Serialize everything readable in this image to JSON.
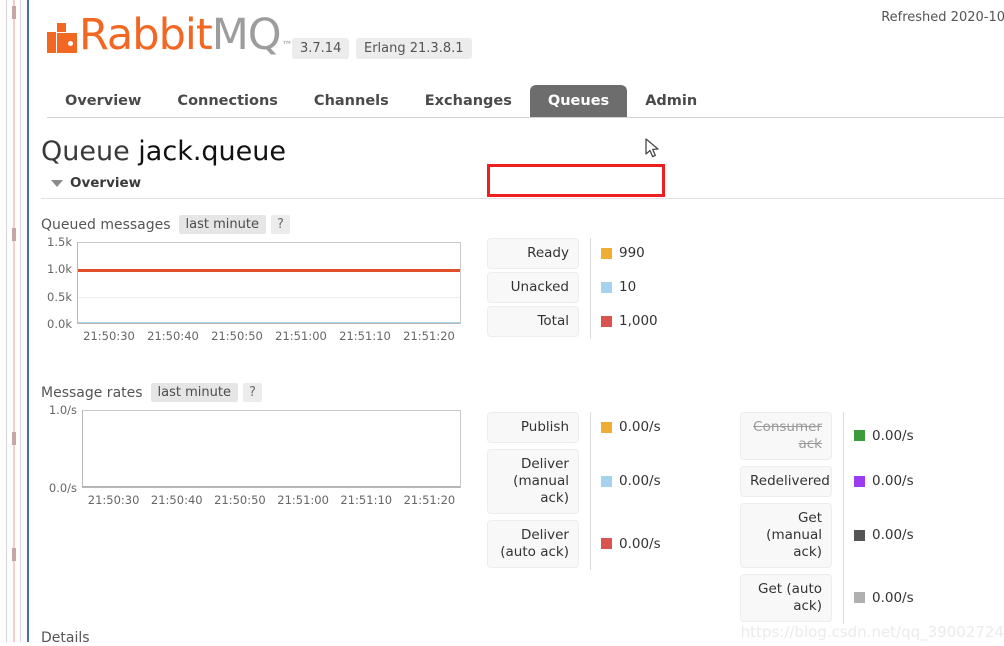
{
  "header": {
    "logo_rabbit": "Rabbit",
    "logo_mq": "MQ",
    "logo_tm": "™",
    "broker_version": "3.7.14",
    "erlang_version": "Erlang 21.3.8.1",
    "refreshed": "Refreshed 2020-10"
  },
  "nav": {
    "tabs": [
      {
        "label": "Overview",
        "active": false
      },
      {
        "label": "Connections",
        "active": false
      },
      {
        "label": "Channels",
        "active": false
      },
      {
        "label": "Exchanges",
        "active": false
      },
      {
        "label": "Queues",
        "active": true
      },
      {
        "label": "Admin",
        "active": false
      }
    ]
  },
  "page": {
    "title_prefix": "Queue",
    "title_name": "jack.queue",
    "overview_label": "Overview",
    "details_label": "Details",
    "watermark": "https://blog.csdn.net/qq_39002724"
  },
  "queued_messages": {
    "title": "Queued messages",
    "range_chip": "last minute",
    "help": "?"
  },
  "message_rates": {
    "title": "Message rates",
    "range_chip": "last minute",
    "help": "?"
  },
  "queued_legend": {
    "rows": [
      {
        "key": "Ready",
        "value": "990",
        "color": "#f0ad34"
      },
      {
        "key": "Unacked",
        "value": "10",
        "color": "#a5d2f0"
      },
      {
        "key": "Total",
        "value": "1,000",
        "color": "#d9534f"
      }
    ]
  },
  "rates_legend": {
    "left": [
      {
        "key": "Publish",
        "value": "0.00/s",
        "color": "#f0ad34",
        "struck": false
      },
      {
        "key": "Deliver\n(manual\nack)",
        "value": "0.00/s",
        "color": "#a5d2f0",
        "struck": false
      },
      {
        "key": "Deliver\n(auto ack)",
        "value": "0.00/s",
        "color": "#d9534f",
        "struck": false
      }
    ],
    "right": [
      {
        "key": "Consumer\nack",
        "value": "0.00/s",
        "color": "#3c9c3c",
        "struck": true
      },
      {
        "key": "Redelivered",
        "value": "0.00/s",
        "color": "#9b3cf0",
        "struck": false
      },
      {
        "key": "Get\n(manual\nack)",
        "value": "0.00/s",
        "color": "#555555",
        "struck": false
      },
      {
        "key": "Get (auto\nack)",
        "value": "0.00/s",
        "color": "#b0b0b0",
        "struck": false
      }
    ]
  },
  "chart_data": [
    {
      "type": "line",
      "title": "Queued messages",
      "xlabel": "",
      "ylabel": "",
      "x": [
        "21:50:30",
        "21:50:40",
        "21:50:50",
        "21:51:00",
        "21:51:10",
        "21:51:20"
      ],
      "yticks": [
        "0.0k",
        "0.5k",
        "1.0k",
        "1.5k"
      ],
      "ylim": [
        0,
        1500
      ],
      "grid": true,
      "legend_position": "right",
      "series": [
        {
          "name": "Total",
          "color": "#e04e2a",
          "values": [
            1000,
            1000,
            1000,
            1000,
            1000,
            1000
          ]
        },
        {
          "name": "Unacked",
          "color": "#a5d2f0",
          "values": [
            10,
            10,
            10,
            10,
            10,
            10
          ]
        }
      ]
    },
    {
      "type": "line",
      "title": "Message rates",
      "xlabel": "",
      "ylabel": "",
      "x": [
        "21:50:30",
        "21:50:40",
        "21:50:50",
        "21:51:00",
        "21:51:10",
        "21:51:20"
      ],
      "yticks": [
        "0.0/s",
        "1.0/s"
      ],
      "ylim": [
        0,
        1
      ],
      "grid": false,
      "legend_position": "right",
      "series": [
        {
          "name": "Publish",
          "color": "#f0ad34",
          "values": [
            0,
            0,
            0,
            0,
            0,
            0
          ]
        },
        {
          "name": "Deliver (manual ack)",
          "color": "#a5d2f0",
          "values": [
            0,
            0,
            0,
            0,
            0,
            0
          ]
        },
        {
          "name": "Deliver (auto ack)",
          "color": "#d9534f",
          "values": [
            0,
            0,
            0,
            0,
            0,
            0
          ]
        },
        {
          "name": "Consumer ack",
          "color": "#3c9c3c",
          "values": [
            0,
            0,
            0,
            0,
            0,
            0
          ]
        },
        {
          "name": "Redelivered",
          "color": "#9b3cf0",
          "values": [
            0,
            0,
            0,
            0,
            0,
            0
          ]
        },
        {
          "name": "Get (manual ack)",
          "color": "#555555",
          "values": [
            0,
            0,
            0,
            0,
            0,
            0
          ]
        },
        {
          "name": "Get (auto ack)",
          "color": "#b0b0b0",
          "values": [
            0,
            0,
            0,
            0,
            0,
            0
          ]
        }
      ]
    }
  ]
}
